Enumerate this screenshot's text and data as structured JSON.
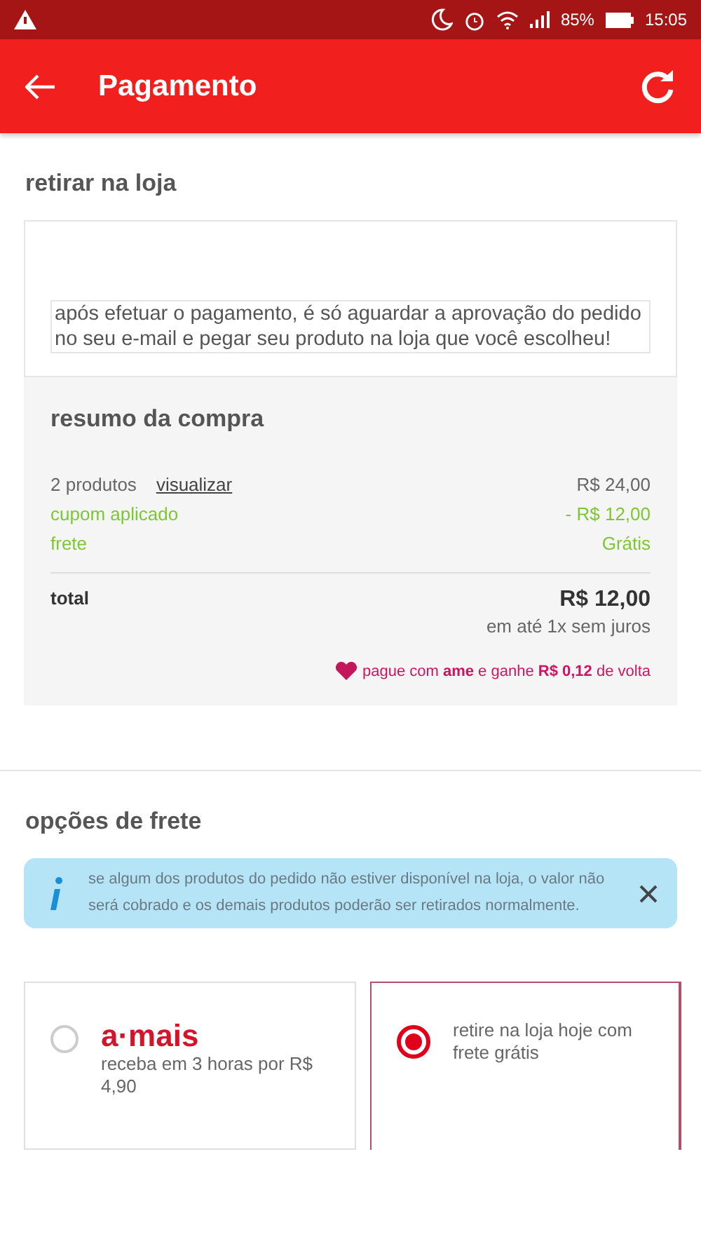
{
  "status_bar": {
    "battery": "85%",
    "time": "15:05"
  },
  "app_bar": {
    "title": "Pagamento"
  },
  "pickup": {
    "title": "retirar na loja",
    "message": "após efetuar o pagamento, é só aguardar a aprovação do pedido no seu e-mail e pegar seu produto na loja que você escolheu!"
  },
  "summary": {
    "title": "resumo da compra",
    "lines": [
      {
        "kind": "products",
        "label": "2 produtos",
        "link": "visualizar",
        "value": "R$ 24,00"
      },
      {
        "kind": "discount",
        "label": "cupom aplicado",
        "value": "- R$ 12,00"
      },
      {
        "kind": "discount",
        "label": "frete",
        "value": "Grátis"
      }
    ],
    "total_label": "total",
    "total_value": "R$ 12,00",
    "installments": "em até 1x sem juros",
    "cashback": "pague com **ame** e ganhe **R$ 0,12** de volta"
  },
  "shipping": {
    "title": "opções de frete",
    "notice": "se algum dos produtos do pedido não estiver disponível na loja, o valor não será cobrado e os demais produtos poderão ser retirados normalmente.",
    "options": [
      {
        "logo": "a·mais",
        "text": "receba em 3 horas por R$ 4,90",
        "selected": false
      },
      {
        "text": "retire na loja hoje com frete grátis",
        "selected": true
      }
    ]
  }
}
